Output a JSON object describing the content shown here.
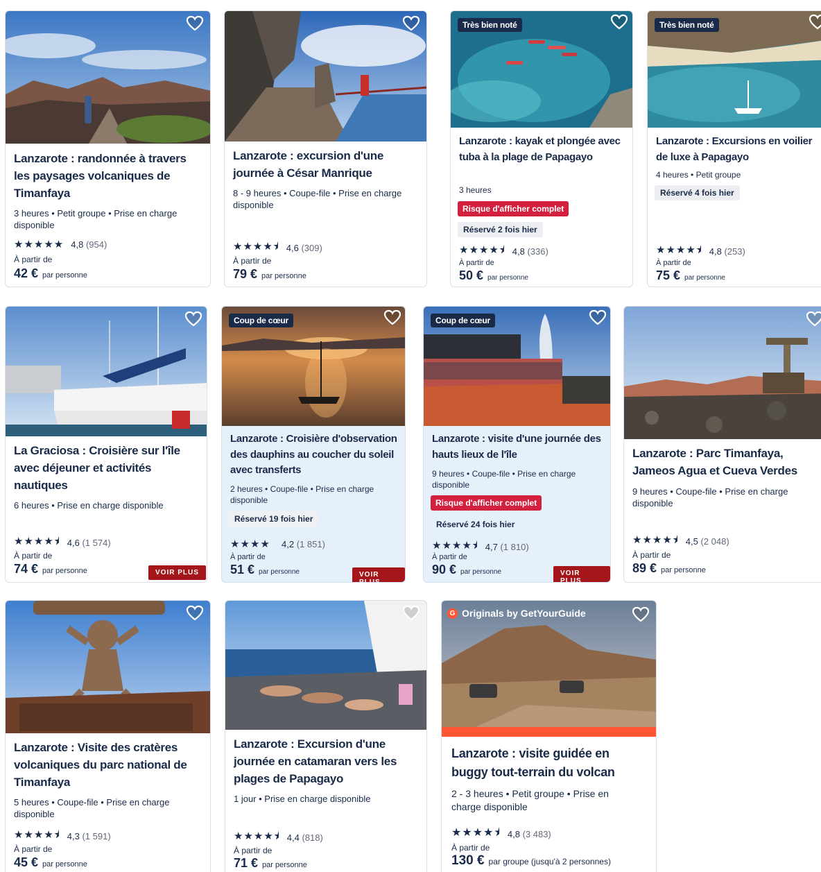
{
  "per_person": "par personne",
  "from_label": "À partir de",
  "more_label": "VOIR PLUS",
  "badges": {
    "top_rated": "Très bien noté",
    "favorite": "Coup de cœur",
    "originals": "Originals by GetYourGuide",
    "originals_logo": "G"
  },
  "cards": [
    {
      "title": "Lanzarote : randonnée à travers les paysages volcaniques de Timanfaya",
      "meta": "3 heures • Petit groupe • Prise en charge disponible",
      "stars": "★★★★★",
      "rating": "4,8",
      "count": "(954)",
      "price": "42 €"
    },
    {
      "title": "Lanzarote : excursion d'une journée à César Manrique",
      "meta": "8 - 9 heures • Coupe-file • Prise en charge disponible",
      "stars": "★★★★⯨",
      "rating": "4,6",
      "count": "(309)",
      "price": "79 €"
    },
    {
      "title": "Lanzarote : kayak et plongée avec tuba à la plage de Papagayo",
      "meta": "3 heures",
      "risk": "Risque d'afficher complet",
      "booked": "Réservé 2 fois hier",
      "stars": "★★★★⯨",
      "rating": "4,8",
      "count": "(336)",
      "price": "50 €"
    },
    {
      "title": "Lanzarote : Excursions en voilier de luxe à Papagayo",
      "meta": "4 heures • Petit groupe",
      "booked": "Réservé 4 fois hier",
      "stars": "★★★★⯨",
      "rating": "4,8",
      "count": "(253)",
      "price": "75 €"
    },
    {
      "title": "La Graciosa : Croisière sur l'île avec déjeuner et activités nautiques",
      "meta": "6 heures • Prise en charge disponible",
      "stars": "★★★★⯨",
      "rating": "4,6",
      "count": "(1 574)",
      "price": "74 €"
    },
    {
      "title": "Lanzarote : Croisière d'observation des dauphins au coucher du soleil avec transferts",
      "meta": "2 heures • Coupe-file • Prise en charge disponible",
      "booked": "Réservé 19 fois hier",
      "stars": "★★★★",
      "rating": "4,2",
      "count": "(1 851)",
      "price": "51 €"
    },
    {
      "title": "Lanzarote : visite d'une journée des hauts lieux de l'île",
      "meta": "9 heures • Coupe-file • Prise en charge disponible",
      "risk": "Risque d'afficher complet",
      "booked": "Réservé 24 fois hier",
      "stars": "★★★★⯨",
      "rating": "4,7",
      "count": "(1 810)",
      "price": "90 €"
    },
    {
      "title": "Lanzarote : Parc Timanfaya, Jameos Agua et Cueva Verdes",
      "meta": "9 heures • Coupe-file • Prise en charge disponible",
      "stars": "★★★★⯨",
      "rating": "4,5",
      "count": "(2 048)",
      "price": "89 €"
    },
    {
      "title": "Lanzarote : Visite des cratères volcaniques du parc national de Timanfaya",
      "meta": "5 heures • Coupe-file • Prise en charge disponible",
      "stars": "★★★★⯨",
      "rating": "4,3",
      "count": "(1 591)",
      "price": "45 €"
    },
    {
      "title": "Lanzarote : Excursion d'une journée en catamaran vers les plages de Papagayo",
      "meta": "1 jour • Prise en charge disponible",
      "stars": "★★★★⯨",
      "rating": "4,4",
      "count": "(818)",
      "price": "71 €"
    },
    {
      "title": "Lanzarote : visite guidée en buggy tout-terrain du volcan",
      "meta": "2 - 3 heures • Petit groupe • Prise en charge disponible",
      "stars": "★★★★⯨",
      "rating": "4,8",
      "count": "(3 483)",
      "price": "130 €",
      "unit": "par groupe (jusqu'à 2 personnes)"
    }
  ],
  "colors": {
    "text": "#1a2b49",
    "risk": "#d3203f",
    "more": "#a4161a",
    "gyg": "#ff5533",
    "shaded": "#e6f0fb"
  },
  "icons": [
    "heart-icon",
    "star-icon",
    "half-star-icon"
  ]
}
